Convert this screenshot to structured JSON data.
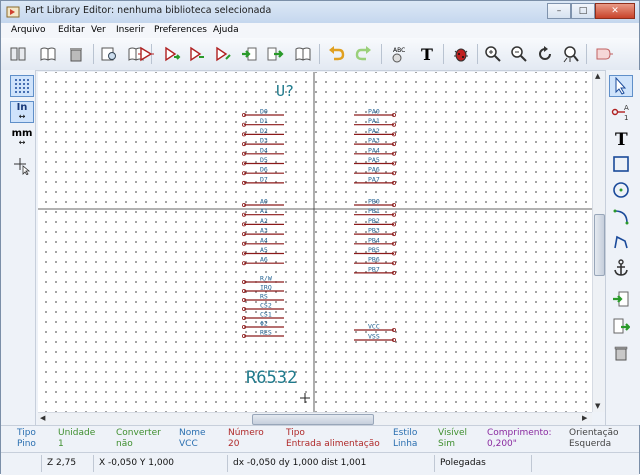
{
  "window": {
    "title": "Part Library Editor: nenhuma biblioteca selecionada"
  },
  "menu": {
    "items": [
      "Arquivo",
      "Editar",
      "Ver",
      "Inserir",
      "Preferences",
      "Ajuda"
    ]
  },
  "toolbar": {
    "icons": [
      "library-icon",
      "library-browse-icon",
      "delete-library-icon",
      "view-docs-icon",
      "book-icon",
      "new-component-icon",
      "load-component-icon",
      "component-icon",
      "import-component-icon",
      "export-component-icon",
      "save-component-icon",
      "datasheet-icon",
      "undo-icon",
      "redo-icon",
      "spellcheck-icon",
      "text-icon",
      "erc-bug-icon",
      "zoom-in-icon",
      "zoom-out-icon",
      "zoom-redraw-icon",
      "zoom-fit-icon",
      "pin-table-icon"
    ]
  },
  "left_toolbar": {
    "grid_label": "grid",
    "in_label": "In",
    "mm_label": "mm"
  },
  "component": {
    "reference": "U?",
    "value": "R6532",
    "left_pins": [
      "D0",
      "D1",
      "D2",
      "D3",
      "D4",
      "D5",
      "D6",
      "D7",
      "A0",
      "A1",
      "A2",
      "A3",
      "A4",
      "A5",
      "A6",
      "R/W",
      "IRQ",
      "RS",
      "CS2",
      "CS1",
      "Φ2",
      "RES"
    ],
    "right_pins": [
      "PA0",
      "PA1",
      "PA2",
      "PA3",
      "PA4",
      "PA5",
      "PA6",
      "PA7",
      "PB0",
      "PB1",
      "PB2",
      "PB3",
      "PB4",
      "PB5",
      "PB6",
      "PB7",
      "VCC",
      "VSS"
    ]
  },
  "info": {
    "tipo": {
      "h": "Tipo",
      "v": "Pino"
    },
    "unidade": {
      "h": "Unidade",
      "v": "1"
    },
    "converter": {
      "h": "Converter",
      "v": "não"
    },
    "nome": {
      "h": "Nome",
      "v": "VCC"
    },
    "numero": {
      "h": "Número",
      "v": "20"
    },
    "tipo2": {
      "h": "Tipo",
      "v": "Entrada alimentação"
    },
    "estilo": {
      "h": "Estilo",
      "v": "Linha"
    },
    "visivel": {
      "h": "Visível",
      "v": "Sim"
    },
    "comprimento": {
      "h": "Comprimento:",
      "v": "0,200\""
    },
    "orientacao": {
      "h": "Orientação",
      "v": "Esquerda"
    }
  },
  "status": {
    "zoom": "Z 2,75",
    "xy": "X -0,050  Y 1,000",
    "dxdy": "dx -0,050  dy 1,000  dist 1,001",
    "units": "Polegadas"
  },
  "colors": {
    "pin": "#8b1a1a",
    "pin_text": "#1f5f8f",
    "ref_text": "#1f7a8c",
    "info_header": "#2a6fb0",
    "info_value_green": "#3f8f2f",
    "info_value_red": "#b02a2a",
    "info_value_purple": "#8a2aa0"
  }
}
